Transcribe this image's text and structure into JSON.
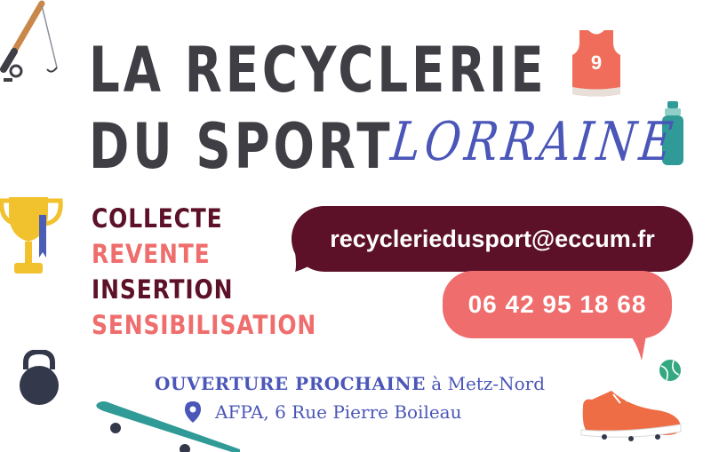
{
  "title": {
    "line1": "LA RECYCLERIE",
    "line2": "DU SPORT",
    "region": "LORRAINE"
  },
  "activities": [
    "COLLECTE",
    "REVENTE",
    "INSERTION",
    "SENSIBILISATION"
  ],
  "contact": {
    "email": "recycleriedusport@eccum.fr",
    "phone": "06 42 95 18 68"
  },
  "opening": {
    "label": "OUVERTURE PROCHAINE",
    "place": "à Metz-Nord",
    "address": "AFPA, 6 Rue Pierre Boileau"
  },
  "jersey_number": "9",
  "colors": {
    "title": "#3e3e44",
    "accent_blue": "#4a56b8",
    "burgundy": "#5c1128",
    "coral": "#ef6d6d",
    "teal": "#2f9a96",
    "gold": "#f2c12e"
  },
  "icons": [
    "fishing-rod-icon",
    "jersey-icon",
    "water-bottle-icon",
    "trophy-icon",
    "kettlebell-icon",
    "skateboard-icon",
    "tennis-ball-icon",
    "sneaker-icon",
    "location-pin-icon"
  ]
}
